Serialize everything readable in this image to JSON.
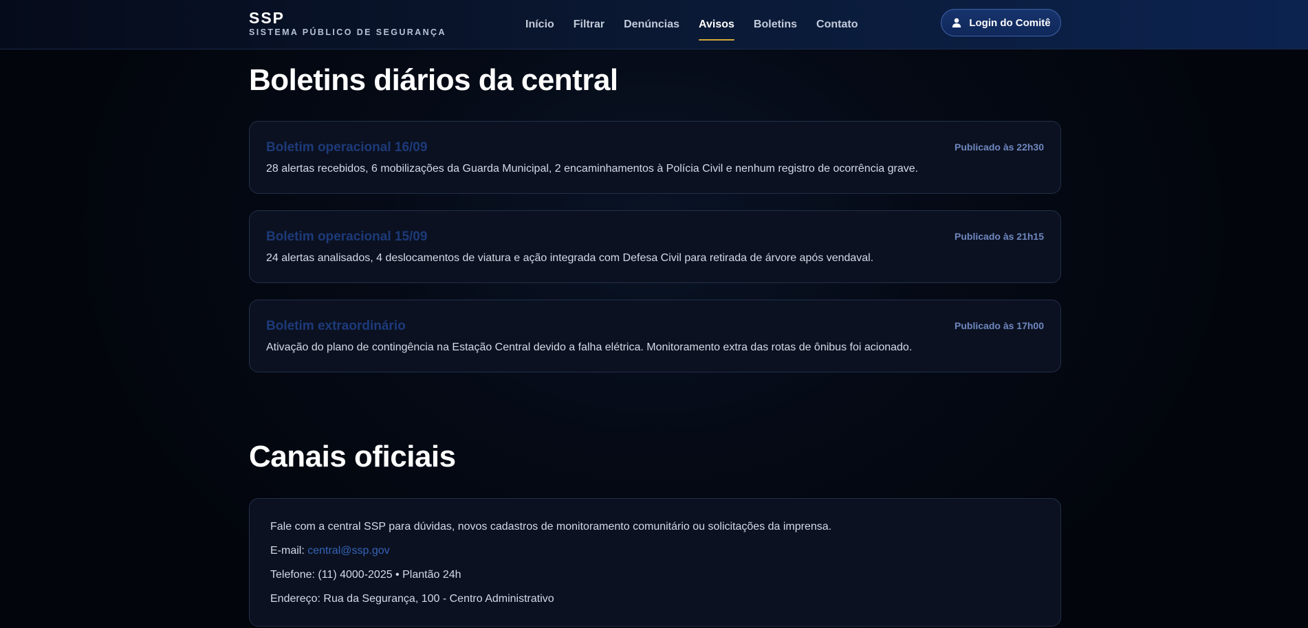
{
  "header": {
    "brand_name": "SSP",
    "brand_subtitle": "SISTEMA PÚBLICO DE SEGURANÇA",
    "nav": [
      {
        "label": "Início",
        "active": false
      },
      {
        "label": "Filtrar",
        "active": false
      },
      {
        "label": "Denúncias",
        "active": false
      },
      {
        "label": "Avisos",
        "active": true
      },
      {
        "label": "Boletins",
        "active": false
      },
      {
        "label": "Contato",
        "active": false
      }
    ],
    "login_label": "Login do Comitê",
    "login_icon": "user-icon"
  },
  "bulletins": {
    "heading": "Boletins diários da central",
    "items": [
      {
        "title": "Boletim operacional 16/09",
        "published": "Publicado às 22h30",
        "body": "28 alertas recebidos, 6 mobilizações da Guarda Municipal, 2 encaminhamentos à Polícia Civil e nenhum registro de ocorrência grave."
      },
      {
        "title": "Boletim operacional 15/09",
        "published": "Publicado às 21h15",
        "body": "24 alertas analisados, 4 deslocamentos de viatura e ação integrada com Defesa Civil para retirada de árvore após vendaval."
      },
      {
        "title": "Boletim extraordinário",
        "published": "Publicado às 17h00",
        "body": "Ativação do plano de contingência na Estação Central devido a falha elétrica. Monitoramento extra das rotas de ônibus foi acionado."
      }
    ]
  },
  "channels": {
    "heading": "Canais oficiais",
    "intro": "Fale com a central SSP para dúvidas, novos cadastros de monitoramento comunitário ou solicitações da imprensa.",
    "email_label": "E-mail: ",
    "email": "central@ssp.gov",
    "phone": "Telefone: (11) 4000-2025 • Plantão 24h",
    "address": "Endereço: Rua da Segurança, 100 - Centro Administrativo"
  },
  "colors": {
    "accent_gold": "#d4a93b",
    "link_blue": "#3563b8",
    "card_title_blue": "#1d3a7a",
    "header_navy": "#0b1f44"
  }
}
